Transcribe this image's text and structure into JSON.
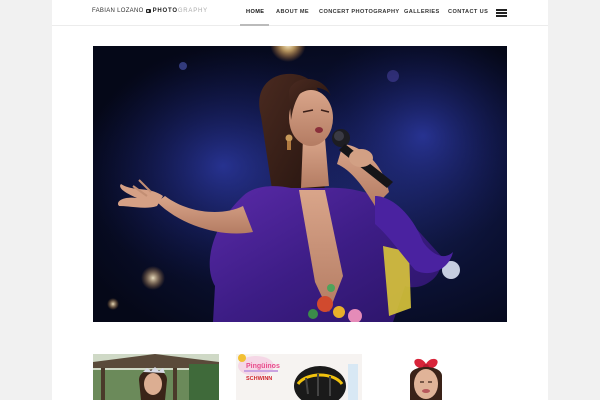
{
  "logo": {
    "name": "FABIAN LOZANO",
    "brand": "PHOTO",
    "brand_light": "GRAPHY"
  },
  "nav": {
    "items": [
      {
        "label": "HOME",
        "active": true
      },
      {
        "label": "ABOUT ME",
        "active": false
      },
      {
        "label": "CONCERT PHOTOGRAPHY",
        "active": false
      },
      {
        "label": "GALLERIES",
        "active": false
      },
      {
        "label": "CONTACT US",
        "active": false
      }
    ],
    "menu_icon": "hamburger-icon"
  },
  "hero": {
    "subject": "concert-singer-photo"
  },
  "thumbnails": [
    {
      "subject": "quinceanera-photo"
    },
    {
      "subject": "kids-event-photo",
      "text_top": "Pingüinos",
      "text_brand": "SCHWINN"
    },
    {
      "subject": "cheer-girl-photo"
    }
  ],
  "colors": {
    "page_bg": "#ffffff",
    "outer_bg": "#f1f1f1",
    "nav_text": "#333333",
    "active_underline": "#bbbbbb"
  }
}
